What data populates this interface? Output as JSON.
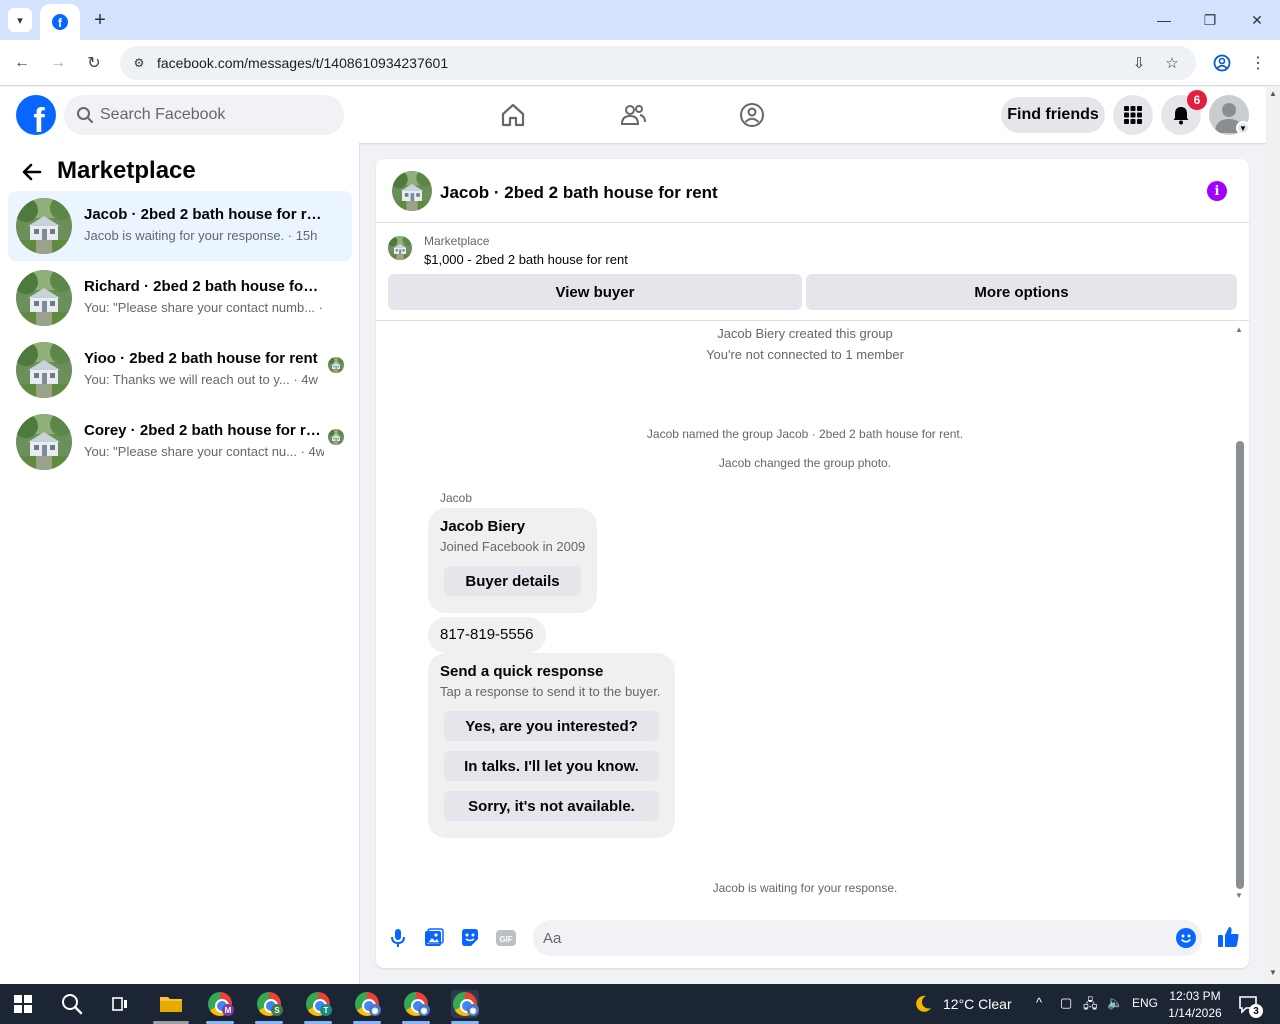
{
  "browser": {
    "url": "facebook.com/messages/t/1408610934237601",
    "tab_favicon": "facebook-icon"
  },
  "header": {
    "search_placeholder": "Search Facebook",
    "find_friends_label": "Find friends",
    "notification_count": "6"
  },
  "sidebar": {
    "title": "Marketplace",
    "conversations": [
      {
        "name": "Jacob · 2bed 2 bath house for rent",
        "preview": "Jacob is waiting for your response. · 15h",
        "active": true
      },
      {
        "name": "Richard · 2bed 2 bath house for rent",
        "preview": "You: \"Please share your contact numb... · 3w",
        "active": false
      },
      {
        "name": "Yioo · 2bed 2 bath house for rent",
        "preview": "You: Thanks we will reach out to y...  · 4w",
        "active": false
      },
      {
        "name": "Corey · 2bed 2 bath house for re...",
        "preview": "You: \"Please share your contact nu...  · 4w",
        "active": false
      }
    ]
  },
  "chat": {
    "title": "Jacob · 2bed 2 bath house for rent",
    "listing": {
      "category": "Marketplace",
      "description": "$1,000 - 2bed 2 bath house for rent",
      "view_buyer_label": "View buyer",
      "more_options_label": "More options"
    },
    "system_messages": [
      "Jacob Biery created this group",
      "You're not connected to 1 member",
      "Jacob named the group Jacob · 2bed 2 bath house for rent.",
      "Jacob changed the group photo."
    ],
    "sender_label": "Jacob",
    "profile_card": {
      "name": "Jacob Biery",
      "joined": "Joined Facebook in 2009",
      "button_label": "Buyer details"
    },
    "phone_message": "817-819-5556",
    "quick_response": {
      "title": "Send a quick response",
      "subtitle": "Tap a response to send it to the buyer.",
      "options": [
        "Yes, are you interested?",
        "In talks. I'll let you know.",
        "Sorry, it's not available."
      ]
    },
    "waiting_text": "Jacob is waiting for your response.",
    "composer_placeholder": "Aa"
  },
  "taskbar": {
    "weather": "12°C  Clear",
    "language": "ENG",
    "time": "12:03 PM",
    "date": "1/14/2026",
    "notification_count": "3",
    "app_badges": [
      "M",
      "S",
      "T",
      "",
      "",
      ""
    ]
  },
  "colors": {
    "brand": "#0866ff",
    "info_accent": "#a100ff",
    "notif_badge": "#e41e3f"
  }
}
